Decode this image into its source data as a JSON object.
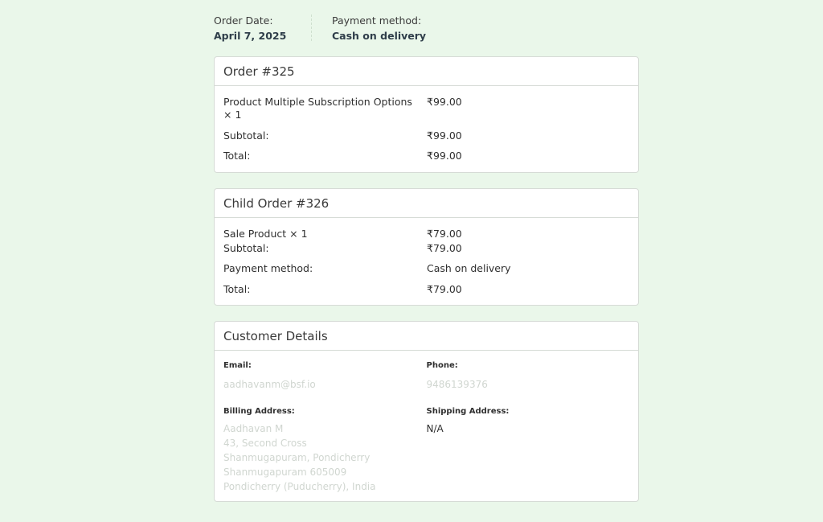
{
  "order_meta": {
    "date_label": "Order Date:",
    "date_value": "April 7, 2025",
    "payment_label": "Payment method:",
    "payment_value": "Cash on delivery"
  },
  "order": {
    "title": "Order #325",
    "item_name": "Product Multiple Subscription Options",
    "item_qty": "× 1",
    "item_price": "₹99.00",
    "subtotal_label": "Subtotal:",
    "subtotal_value": "₹99.00",
    "total_label": "Total:",
    "total_value": "₹99.00"
  },
  "child_order": {
    "title": "Child Order #326",
    "item": "Sale Product × 1",
    "item_price": "₹79.00",
    "subtotal_label": "Subtotal:",
    "subtotal_value": "₹79.00",
    "payment_label": "Payment method:",
    "payment_value": "Cash on delivery",
    "total_label": "Total:",
    "total_value": "₹79.00"
  },
  "customer": {
    "title": "Customer Details",
    "email_label": "Email:",
    "email_value": "aadhavanm@bsf.io",
    "phone_label": "Phone:",
    "phone_value": "9486139376",
    "billing_label": "Billing Address:",
    "billing_lines": [
      "Aadhavan M",
      "43, Second Cross",
      "Shanmugapuram, Pondicherry",
      "Shanmugapuram 605009",
      "Pondicherry (Puducherry), India"
    ],
    "shipping_label": "Shipping Address:",
    "shipping_value": "N/A"
  }
}
